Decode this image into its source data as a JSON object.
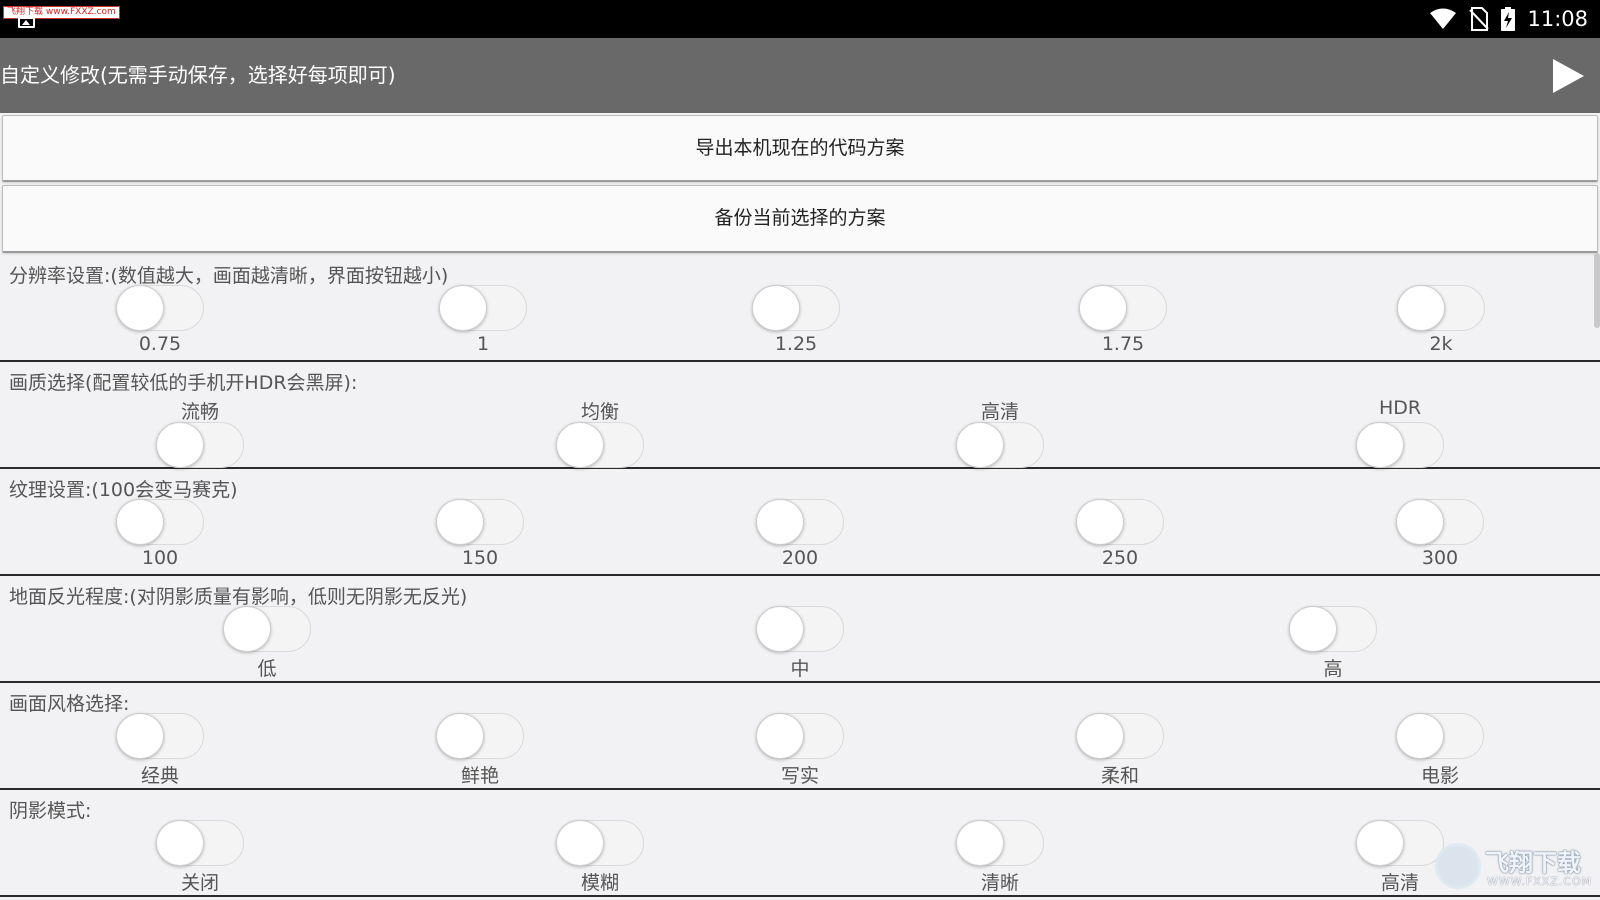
{
  "status_bar": {
    "watermark_text": "飞翔下载 www.FXXZ.com",
    "time": "11:08"
  },
  "app_bar": {
    "title": "自定义修改(无需手动保存，选择好每项即可)"
  },
  "buttons": {
    "export": "导出本机现在的代码方案",
    "backup": "备份当前选择的方案"
  },
  "sections": {
    "resolution": {
      "title": "分辨率设置:(数值越大，画面越清晰，界面按钮越小)",
      "options": [
        "0.75",
        "1",
        "1.25",
        "1.75",
        "2k"
      ]
    },
    "quality": {
      "title": "画质选择(配置较低的手机开HDR会黑屏):",
      "options": [
        "流畅",
        "均衡",
        "高清",
        "HDR"
      ]
    },
    "texture": {
      "title": "纹理设置:(100会变马赛克)",
      "options": [
        "100",
        "150",
        "200",
        "250",
        "300"
      ]
    },
    "reflection": {
      "title": "地面反光程度:(对阴影质量有影响，低则无阴影无反光)",
      "options": [
        "低",
        "中",
        "高"
      ]
    },
    "style": {
      "title": "画面风格选择:",
      "options": [
        "经典",
        "鲜艳",
        "写实",
        "柔和",
        "电影"
      ]
    },
    "shadow": {
      "title": "阴影模式:",
      "options": [
        "关闭",
        "模糊",
        "清晰",
        "高清"
      ]
    }
  },
  "watermark_logo": {
    "title": "飞翔下载",
    "url": "WWW.FXXZ.COM"
  },
  "colors": {
    "status_bar": "#000000",
    "app_bar": "#696969",
    "background": "#f2f2f4",
    "divider": "#2a2a2a"
  }
}
